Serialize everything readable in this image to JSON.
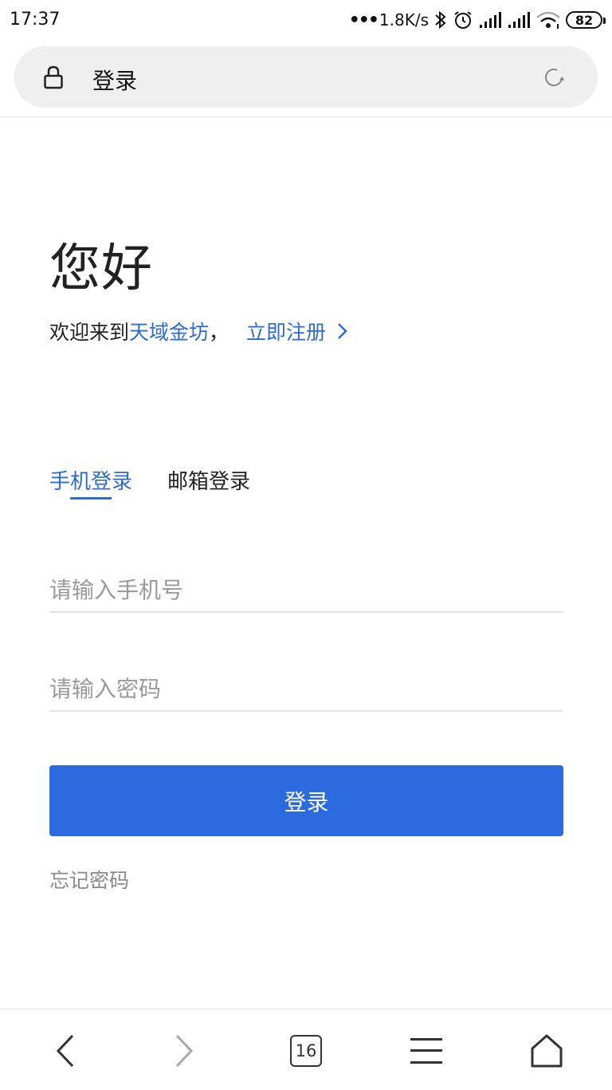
{
  "status_bar": {
    "time": "17:37",
    "net_speed": "1.8K/s",
    "battery": "82",
    "icons": [
      "more-dots-icon",
      "bluetooth-icon",
      "alarm-icon",
      "signal-icon",
      "signal-icon",
      "wifi-icon",
      "battery-icon"
    ]
  },
  "address_bar": {
    "title": "登录",
    "lock_icon": "lock-icon",
    "reload_icon": "reload-icon"
  },
  "page": {
    "greeting": "您好",
    "welcome_prefix": "欢迎来到",
    "brand": "天域金坊",
    "comma": "，",
    "register_link": "立即注册"
  },
  "tabs": [
    {
      "label": "手机登录",
      "active": true
    },
    {
      "label": "邮箱登录",
      "active": false
    }
  ],
  "form": {
    "phone_placeholder": "请输入手机号",
    "phone_value": "",
    "password_placeholder": "请输入密码",
    "password_value": "",
    "login_label": "登录",
    "forgot_label": "忘记密码"
  },
  "bottom_nav": {
    "tab_count": "16",
    "items": [
      "back-icon",
      "forward-icon",
      "tabs-icon",
      "menu-icon",
      "home-icon"
    ]
  },
  "colors": {
    "accent": "#2c6bd6",
    "button": "#2c6bdf",
    "placeholder": "#9a9a9a"
  }
}
